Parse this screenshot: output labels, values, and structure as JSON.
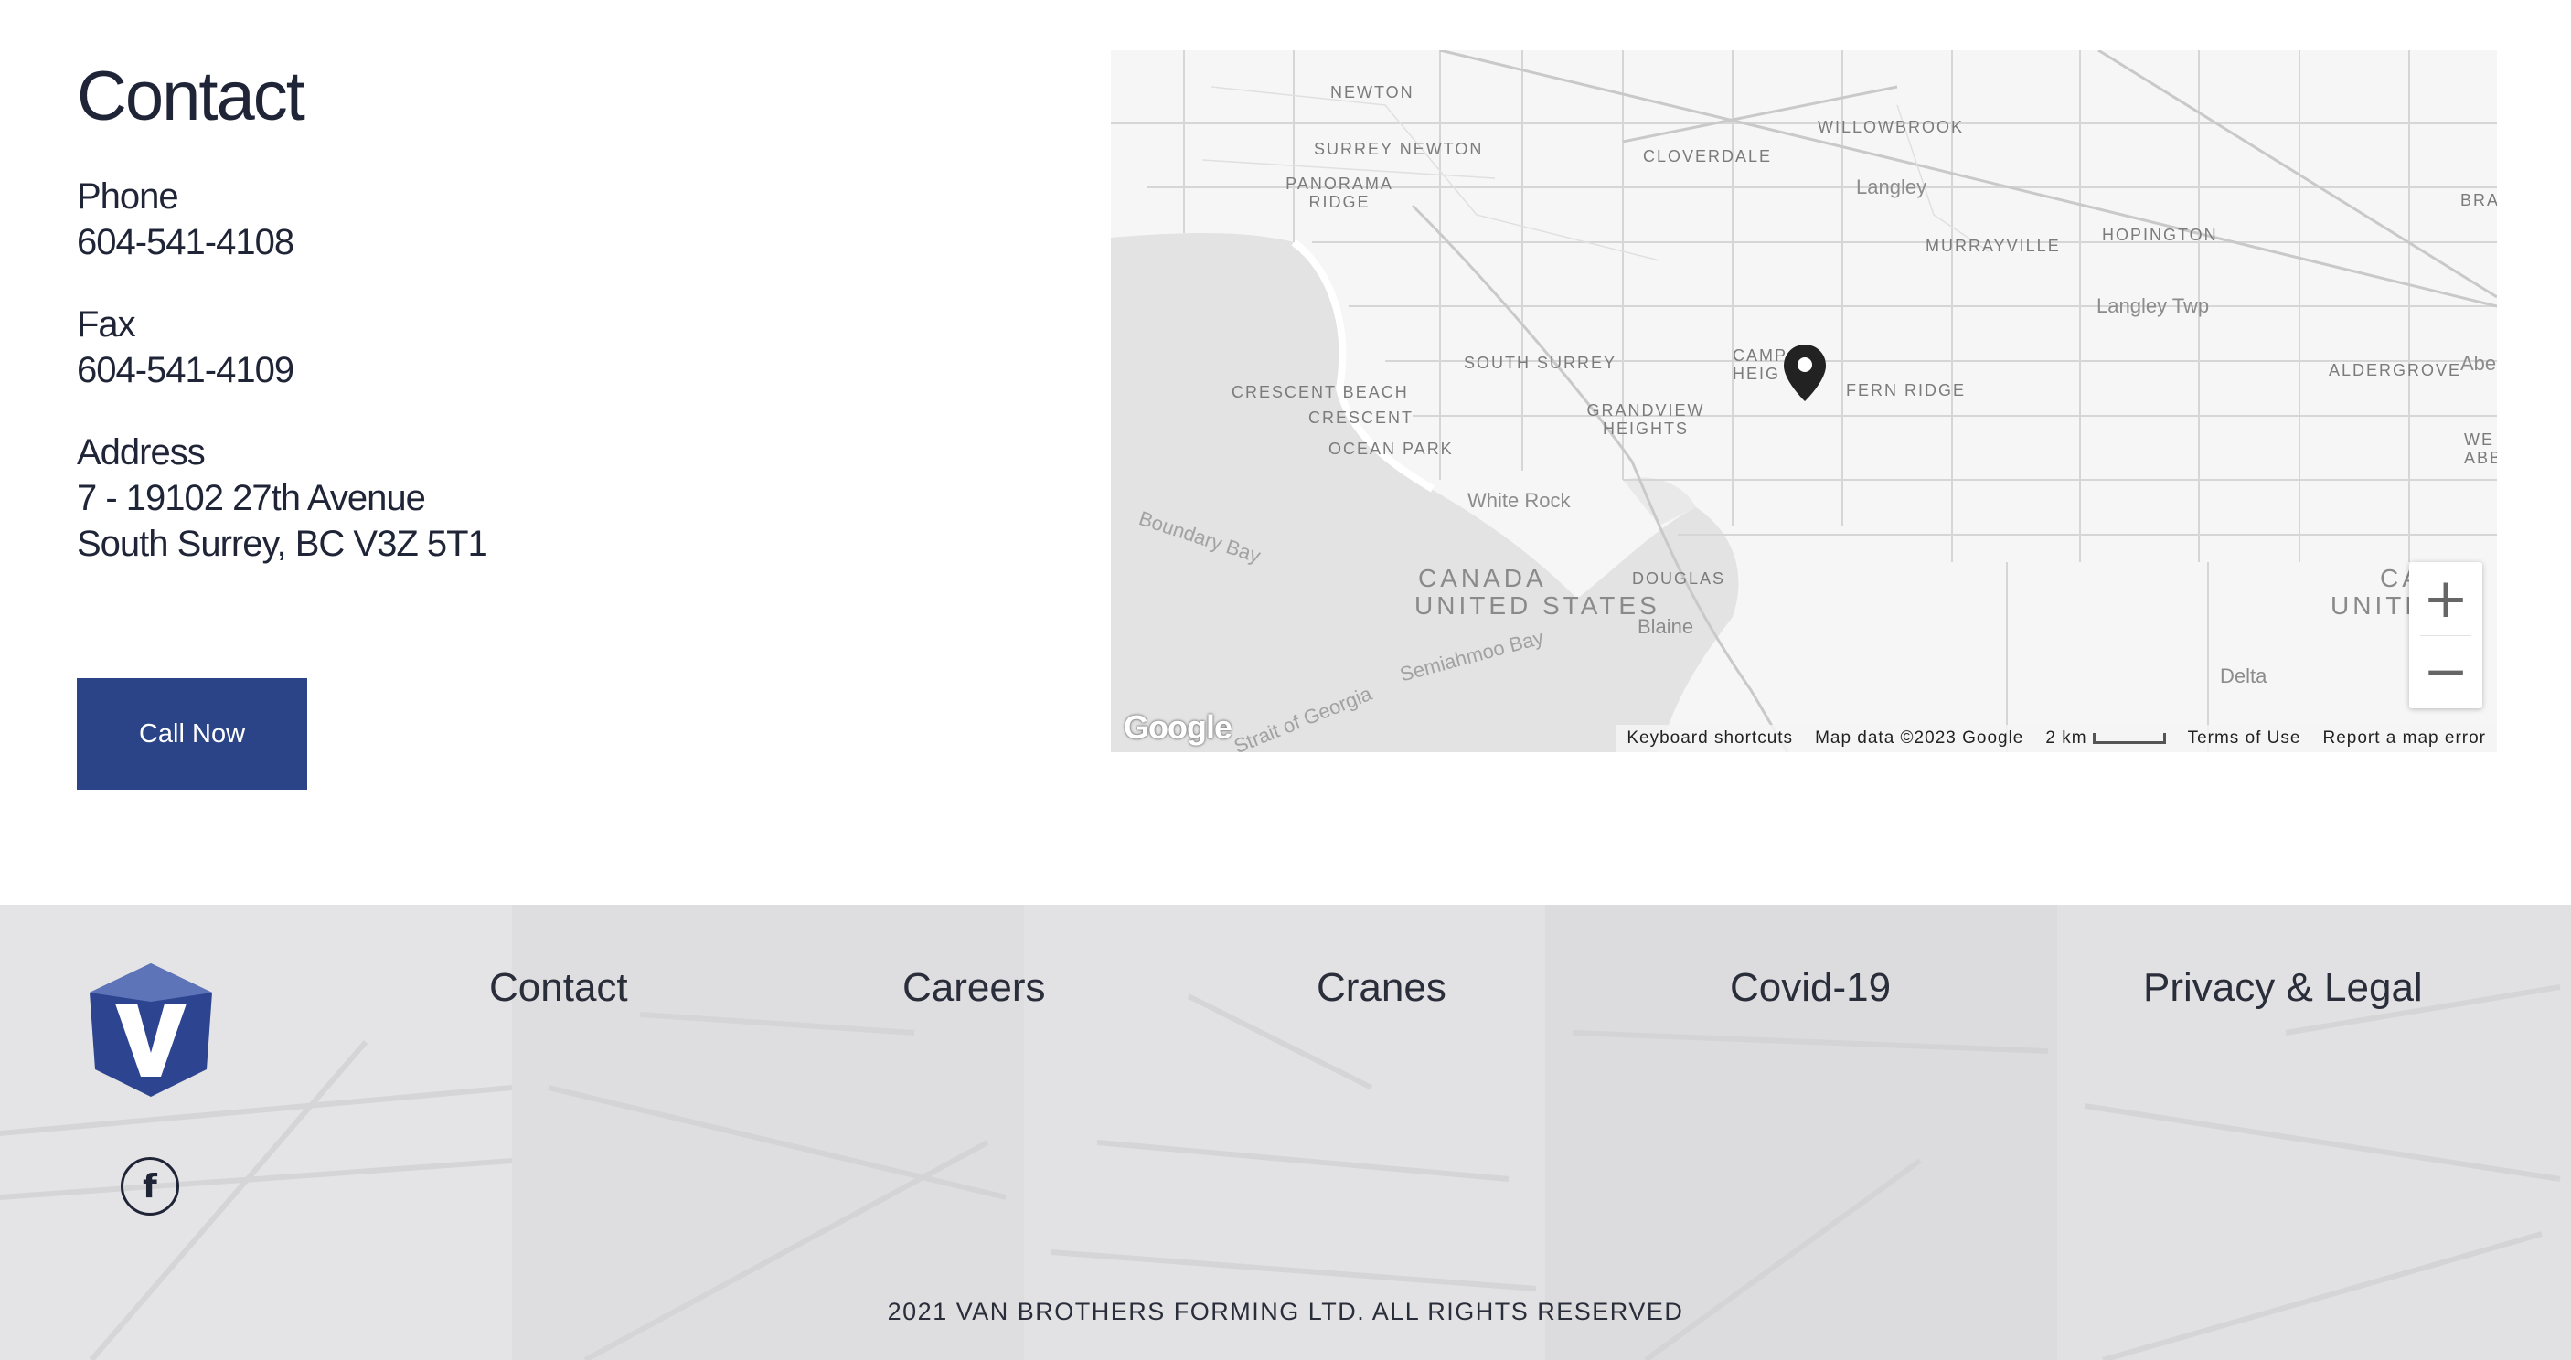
{
  "contact": {
    "title": "Contact",
    "phone_label": "Phone",
    "phone": "604-541-4108",
    "fax_label": "Fax",
    "fax": "604-541-4109",
    "address_label": "Address",
    "address_line1": "7 - 19102 27th Avenue",
    "address_line2": "South Surrey, BC V3Z 5T1",
    "call_button": "Call Now",
    "accent_color": "#2a4487"
  },
  "map": {
    "places": [
      "NEWTON",
      "SURREY NEWTON",
      "PANORAMA RIDGE",
      "CLOVERDALE",
      "WILLOWBROOK",
      "Langley",
      "MURRAYVILLE",
      "HOPINGTON",
      "Langley Twp",
      "BRA",
      "SOUTH SURREY",
      "CAMP HEIG",
      "FERN RIDGE",
      "ALDERGROVE",
      "Abe",
      "CRESCENT BEACH",
      "CRESCENT",
      "GRANDVIEW HEIGHTS",
      "OCEAN PARK",
      "WE ABBOTS",
      "White Rock",
      "Boundary Bay",
      "CANADA",
      "UNITED STATES",
      "DOUGLAS",
      "Blaine",
      "Semiahmoo Bay",
      "Delta",
      "Strait of Georgia",
      "CA",
      "UNITE"
    ],
    "logo_text": "Google",
    "attribution": {
      "keyboard": "Keyboard shortcuts",
      "data": "Map data ©2023 Google",
      "scale": "2 km",
      "terms": "Terms of Use",
      "report": "Report a map error"
    },
    "zoom_in": "+",
    "zoom_out": "−"
  },
  "footer": {
    "nav": [
      "Contact",
      "Careers",
      "Cranes",
      "Covid-19",
      "Privacy & Legal"
    ],
    "logo_letter": "V",
    "social_icon": "f",
    "copyright": "2021 VAN BROTHERS FORMING LTD. ALL RIGHTS RESERVED"
  }
}
